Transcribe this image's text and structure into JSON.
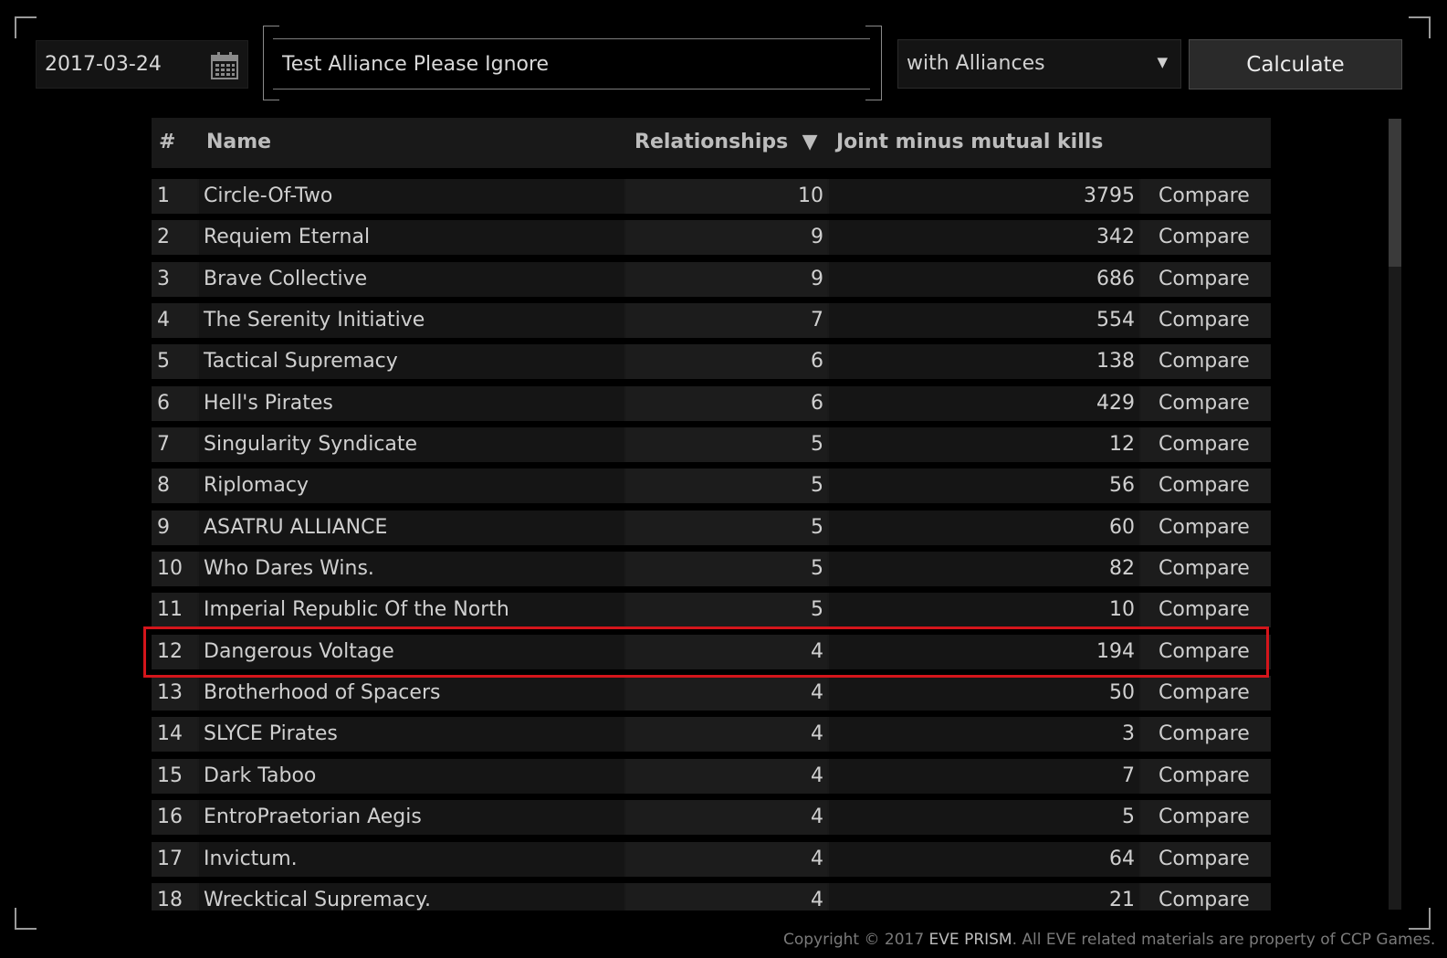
{
  "date_picker": {
    "value": "2017-03-24",
    "icon": "calendar-icon"
  },
  "search": {
    "value": "Test Alliance Please Ignore"
  },
  "select": {
    "value": "with Alliances",
    "arrow": "▼"
  },
  "calculate": {
    "label": "Calculate"
  },
  "table": {
    "headers": {
      "num": "#",
      "name": "Name",
      "relationships": "Relationships",
      "sort_indicator": "▼",
      "joint": "Joint minus mutual kills"
    },
    "compare_label": "Compare",
    "highlighted_rank": "12",
    "rows": [
      {
        "rank": "1",
        "name": "Circle-Of-Two",
        "relationships": "10",
        "joint": "3795"
      },
      {
        "rank": "2",
        "name": "Requiem Eternal",
        "relationships": "9",
        "joint": "342"
      },
      {
        "rank": "3",
        "name": "Brave Collective",
        "relationships": "9",
        "joint": "686"
      },
      {
        "rank": "4",
        "name": "The Serenity Initiative",
        "relationships": "7",
        "joint": "554"
      },
      {
        "rank": "5",
        "name": "Tactical Supremacy",
        "relationships": "6",
        "joint": "138"
      },
      {
        "rank": "6",
        "name": "Hell's Pirates",
        "relationships": "6",
        "joint": "429"
      },
      {
        "rank": "7",
        "name": "Singularity Syndicate",
        "relationships": "5",
        "joint": "12"
      },
      {
        "rank": "8",
        "name": "Riplomacy",
        "relationships": "5",
        "joint": "56"
      },
      {
        "rank": "9",
        "name": "ASATRU ALLIANCE",
        "relationships": "5",
        "joint": "60"
      },
      {
        "rank": "10",
        "name": "Who Dares Wins.",
        "relationships": "5",
        "joint": "82"
      },
      {
        "rank": "11",
        "name": "Imperial Republic Of the North",
        "relationships": "5",
        "joint": "10"
      },
      {
        "rank": "12",
        "name": "Dangerous Voltage",
        "relationships": "4",
        "joint": "194"
      },
      {
        "rank": "13",
        "name": "Brotherhood of Spacers",
        "relationships": "4",
        "joint": "50"
      },
      {
        "rank": "14",
        "name": "SLYCE Pirates",
        "relationships": "4",
        "joint": "3"
      },
      {
        "rank": "15",
        "name": "Dark Taboo",
        "relationships": "4",
        "joint": "7"
      },
      {
        "rank": "16",
        "name": "EntroPraetorian Aegis",
        "relationships": "4",
        "joint": "5"
      },
      {
        "rank": "17",
        "name": "Invictum.",
        "relationships": "4",
        "joint": "64"
      },
      {
        "rank": "18",
        "name": "Wrecktical Supremacy.",
        "relationships": "4",
        "joint": "21"
      }
    ]
  },
  "footer": {
    "prefix": "Copyright © 2017 ",
    "brand": "EVE PRISM",
    "suffix": ". All EVE related materials are property of CCP Games."
  },
  "colors": {
    "highlight": "#d4151b",
    "background": "#000000",
    "row": "#1a1a1a"
  }
}
